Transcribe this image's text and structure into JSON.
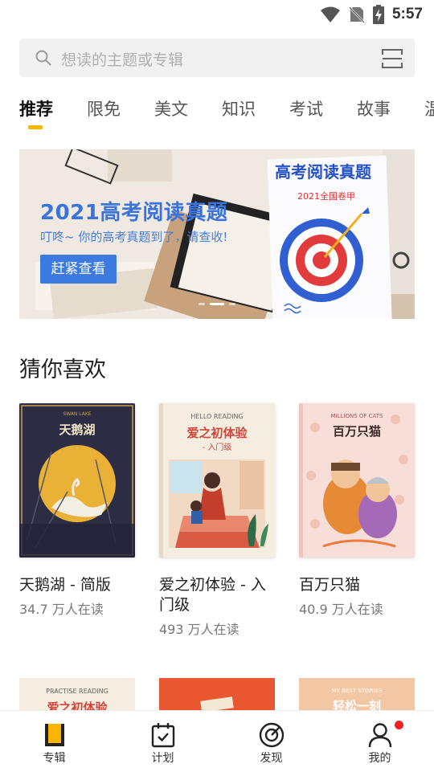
{
  "status_bar": {
    "time": "5:57",
    "icons": [
      "wifi-icon",
      "no-sim-icon",
      "battery-charging-icon"
    ]
  },
  "search": {
    "placeholder": "想读的主题或专辑",
    "icon": "search-icon",
    "scan_icon": "scan-icon"
  },
  "tabs": [
    "推荐",
    "限免",
    "美文",
    "知识",
    "考试",
    "故事",
    "温"
  ],
  "active_tab": "推荐",
  "banner": {
    "title": "2021高考阅读真题",
    "subtitle": "叮咚~ 你的高考真题到了，请查收!",
    "button": "赶紧查看",
    "card_title": "高考阅读真题",
    "card_badge": "2021全国卷甲",
    "page_indicator": {
      "count": 3,
      "active": 1
    }
  },
  "section_title": "猜你喜欢",
  "books": [
    {
      "title": "天鹅湖 - 简版",
      "readers": "34.7 万人在读",
      "cover_text": "天鹅湖",
      "cover_top": "SWAN LAKE"
    },
    {
      "title": "爱之初体验 - 入门级",
      "readers": "493 万人在读",
      "cover_text": "爱之初体验",
      "cover_sub": "- 入门级",
      "cover_top": "HELLO READING"
    },
    {
      "title": "百万只猫",
      "readers": "40.9 万人在读",
      "cover_text": "百万只猫",
      "cover_top": "MILLIONS OF CATS"
    }
  ],
  "books_row2": [
    {
      "cover_text": "爱之初体验",
      "cover_top": "PRACTISE READING"
    },
    {
      "cover_text": ""
    },
    {
      "cover_text": "轻松一刻",
      "cover_top": "MY BEST STORIES"
    }
  ],
  "bottom_nav": [
    {
      "label": "专辑",
      "icon": "album-icon"
    },
    {
      "label": "计划",
      "icon": "calendar-check-icon"
    },
    {
      "label": "发现",
      "icon": "compass-icon"
    },
    {
      "label": "我的",
      "icon": "user-icon",
      "badge": true
    }
  ],
  "colors": {
    "accent": "#f7b500",
    "banner_blue": "#3b7ae0",
    "badge_red": "#ee2222"
  }
}
